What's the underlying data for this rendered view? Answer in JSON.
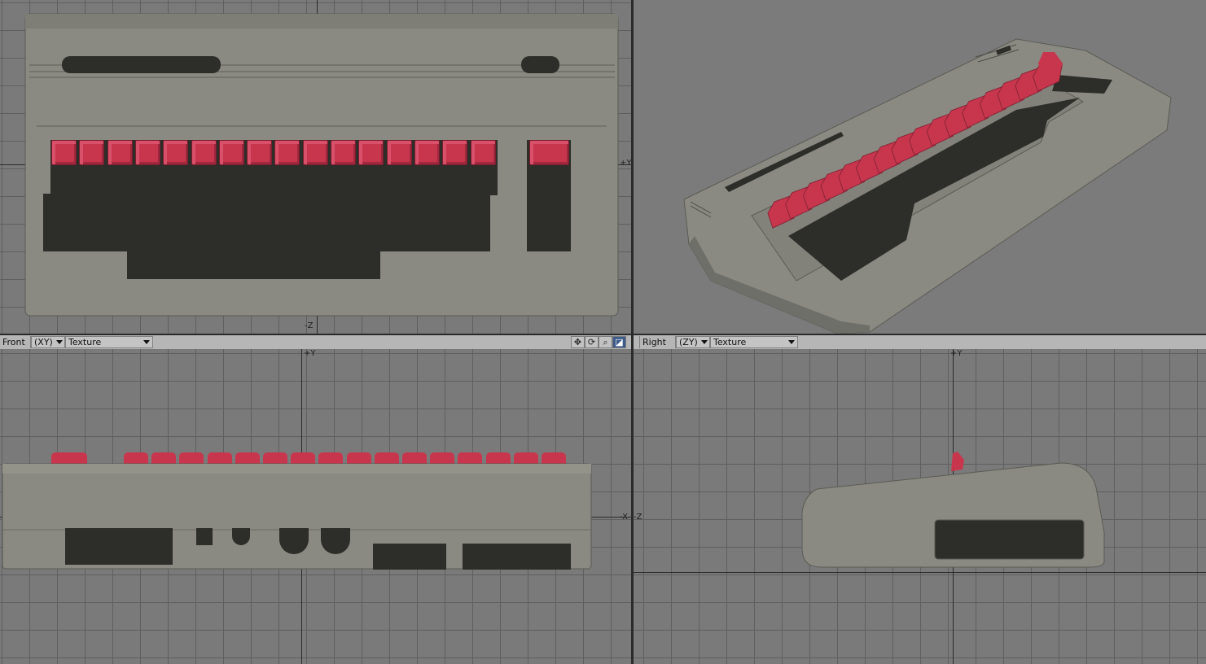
{
  "app": {
    "viewports": {
      "top": {
        "axis_labels": {
          "neg_z": "-Z",
          "pos_y_right": "+Y"
        }
      },
      "perspective": {},
      "front": {
        "view_name": "Front",
        "plane": "(XY)",
        "shading": "Texture",
        "axis_labels": {
          "pos_y": "+Y",
          "neg_x": "-X"
        }
      },
      "right": {
        "view_name": "Right",
        "plane": "(ZY)",
        "shading": "Texture",
        "axis_labels": {
          "pos_y": "+Y",
          "neg_z": "-Z"
        }
      }
    },
    "tools": [
      {
        "name": "move-view-icon",
        "glyph": "✥"
      },
      {
        "name": "rotate-view-icon",
        "glyph": "⟳"
      },
      {
        "name": "zoom-view-icon",
        "glyph": "⌕"
      },
      {
        "name": "maximize-view-icon",
        "glyph": "◪"
      }
    ],
    "colors": {
      "case": "#8a8a82",
      "keys": "#c8364d",
      "dark": "#2d2d29"
    }
  }
}
